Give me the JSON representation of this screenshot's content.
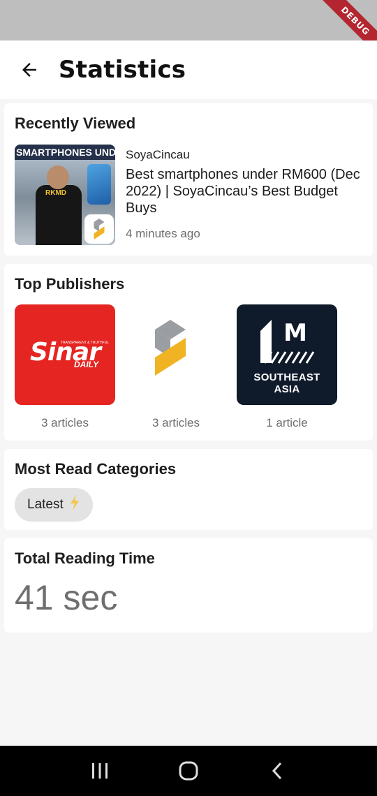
{
  "debug_banner": "DEBUG",
  "header": {
    "title": "Statistics"
  },
  "recently_viewed": {
    "title": "Recently Viewed",
    "thumbnail_text": "SMARTPHONES UNDER",
    "thumbnail_shirt": "RKMD",
    "publisher": "SoyaCincau",
    "article_title": "Best smartphones under RM600 (Dec 2022) | SoyaCincau’s Best Budget Buys",
    "time_ago": "4 minutes ago"
  },
  "top_publishers": {
    "title": "Top Publishers",
    "items": [
      {
        "logo": "sinar-daily-logo",
        "logo_text": "Sinar",
        "logo_sub": "DAILY",
        "logo_tag": "TRANSPARENT & TRUTHFUL",
        "count": "3 articles"
      },
      {
        "logo": "soyacincau-logo",
        "count": "3 articles"
      },
      {
        "logo": "mashable-se-asia-logo",
        "logo_letter": "M",
        "logo_line1": "SOUTHEAST",
        "logo_line2": "ASIA",
        "count": "1 article"
      }
    ]
  },
  "categories": {
    "title": "Most Read Categories",
    "chips": [
      {
        "label": "Latest",
        "icon": "lightning-icon"
      }
    ]
  },
  "reading_time": {
    "title": "Total Reading Time",
    "value": "41 sec"
  },
  "colors": {
    "background": "#f6f6f6",
    "card": "#ffffff",
    "sinar_red": "#e52521",
    "soya_yellow": "#f0b323",
    "soya_gray": "#9a9da2",
    "mashable_navy": "#0f1a2a",
    "debug_red": "#b3262f"
  }
}
